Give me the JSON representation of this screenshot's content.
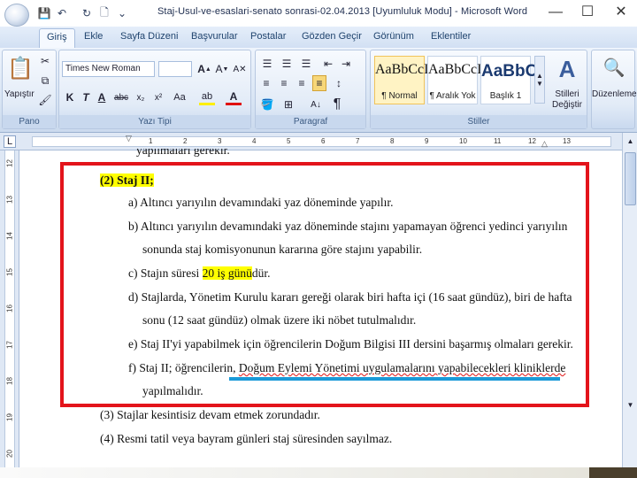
{
  "window": {
    "title": "Staj-Usul-ve-esaslari-senato sonrasi-02.04.2013 [Uyumluluk Modu] - Microsoft Word",
    "minimize": "—",
    "maximize": "☐",
    "close": "✕"
  },
  "quick_access": {
    "save": "💾",
    "undo": "↶",
    "redo": "↻",
    "preview": "🗋",
    "more": "⌄"
  },
  "tabs": [
    "Giriş",
    "Ekle",
    "Sayfa Düzeni",
    "Başvurular",
    "Postalar",
    "Gözden Geçir",
    "Görünüm",
    "Eklentiler"
  ],
  "ribbon": {
    "clipboard": {
      "label": "Pano",
      "paste": "Yapıştır"
    },
    "font": {
      "label": "Yazı Tipi",
      "font_name": "Times New Roman",
      "font_size": "",
      "bold": "K",
      "italic": "T",
      "underline": "A"
    },
    "paragraph": {
      "label": "Paragraf"
    },
    "styles": {
      "label": "Stiller",
      "items": [
        {
          "sample": "AaBbCcI",
          "name": "¶ Normal"
        },
        {
          "sample": "AaBbCcI",
          "name": "¶ Aralık Yok"
        },
        {
          "sample": "AaBbC",
          "name": "Başlık 1"
        }
      ],
      "change_styles": "Stilleri Değiştir"
    },
    "editing": {
      "label": "Düzenleme"
    }
  },
  "ruler": {
    "numbers": [
      "1",
      "2",
      "3",
      "4",
      "5",
      "6",
      "7",
      "8",
      "9",
      "10",
      "11",
      "12",
      "13"
    ]
  },
  "vruler": {
    "numbers": [
      "12",
      "13",
      "14",
      "15",
      "16",
      "17",
      "18",
      "19",
      "20"
    ]
  },
  "document": {
    "cutoff_line": "yapılmaları gerekir.",
    "heading": "(2) Staj II;",
    "items": [
      {
        "line1": "a) Altıncı yarıyılın devamındaki yaz döneminde yapılır."
      },
      {
        "line1": "b) Altıncı yarıyılın devamındaki yaz döneminde stajını yapamayan öğrenci yedinci yarıyılın",
        "line2": "sonunda staj komisyonunun kararına göre stajını yapabilir."
      },
      {
        "pre": "c) Stajın süresi ",
        "hl": "20 iş günü",
        "post": "dür."
      },
      {
        "line1": "d) Stajlarda, Yönetim Kurulu kararı gereği olarak biri hafta içi (16 saat gündüz), biri de hafta",
        "line2": "sonu (12 saat gündüz) olmak üzere iki nöbet tutulmalıdır."
      },
      {
        "line1": "e) Staj II'yi yapabilmek için öğrencilerin Doğum Bilgisi III dersini başarmış olmaları gerekir."
      },
      {
        "pre": "f) Staj II; öğrencilerin, ",
        "ul": "Doğum Eylemi Yönetimi uygulamalarını yapabilecekleri kliniklerde",
        "line2": "yapılmalıdır."
      }
    ],
    "p3": "(3) Stajlar kesintisiz devam etmek zorundadır.",
    "p4": "(4) Resmi tatil veya bayram günleri staj süresinden sayılmaz."
  }
}
